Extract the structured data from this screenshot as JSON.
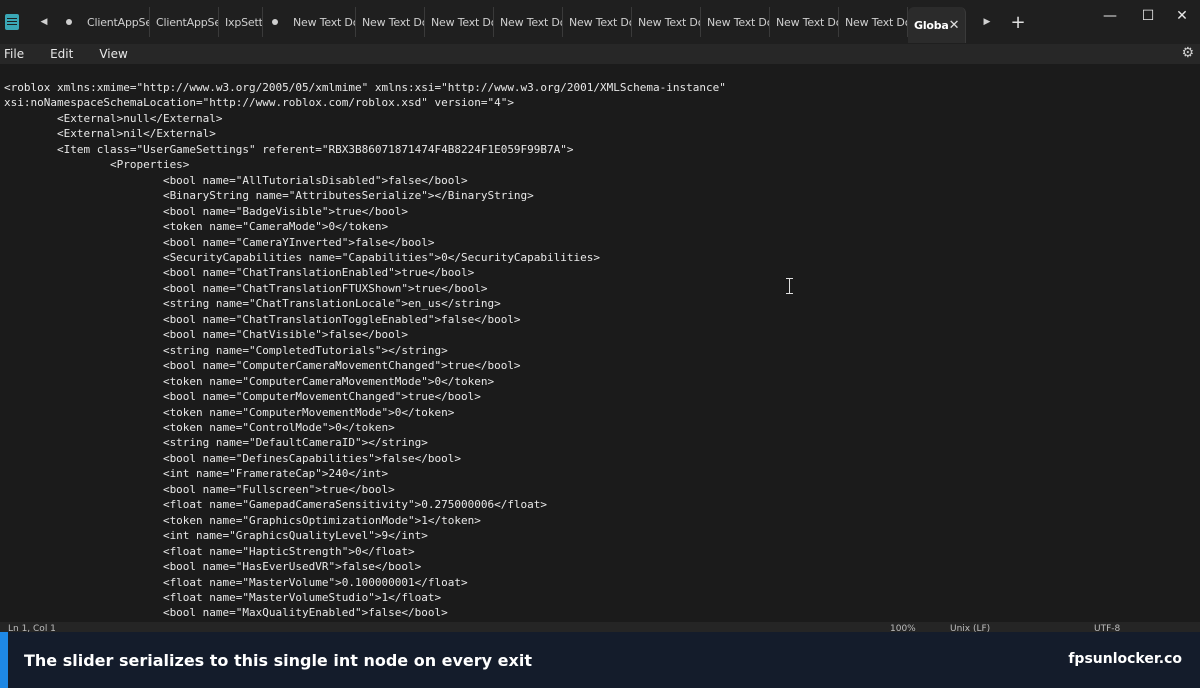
{
  "tabs": [
    {
      "label": "ClientAppSe"
    },
    {
      "label": "ClientAppSe"
    },
    {
      "label": "IxpSett"
    },
    {
      "label": "New Text Do"
    },
    {
      "label": "New Text Do"
    },
    {
      "label": "New Text Do"
    },
    {
      "label": "New Text Do"
    },
    {
      "label": "New Text Do"
    },
    {
      "label": "New Text Do"
    },
    {
      "label": "New Text Do"
    },
    {
      "label": "New Text Do"
    },
    {
      "label": "New Text Do"
    }
  ],
  "active_tab": {
    "label": "Globa",
    "close": "✕"
  },
  "new_tab": "+",
  "window": {
    "minimize": "—",
    "maximize": "☐",
    "close": "✕"
  },
  "menu": {
    "file": "File",
    "edit": "Edit",
    "view": "View"
  },
  "code_text": "<roblox xmlns:xmime=\"http://www.w3.org/2005/05/xmlmime\" xmlns:xsi=\"http://www.w3.org/2001/XMLSchema-instance\"\nxsi:noNamespaceSchemaLocation=\"http://www.roblox.com/roblox.xsd\" version=\"4\">\n        <External>null</External>\n        <External>nil</External>\n        <Item class=\"UserGameSettings\" referent=\"RBX3B86071871474F4B8224F1E059F99B7A\">\n                <Properties>\n                        <bool name=\"AllTutorialsDisabled\">false</bool>\n                        <BinaryString name=\"AttributesSerialize\"></BinaryString>\n                        <bool name=\"BadgeVisible\">true</bool>\n                        <token name=\"CameraMode\">0</token>\n                        <bool name=\"CameraYInverted\">false</bool>\n                        <SecurityCapabilities name=\"Capabilities\">0</SecurityCapabilities>\n                        <bool name=\"ChatTranslationEnabled\">true</bool>\n                        <bool name=\"ChatTranslationFTUXShown\">true</bool>\n                        <string name=\"ChatTranslationLocale\">en_us</string>\n                        <bool name=\"ChatTranslationToggleEnabled\">false</bool>\n                        <bool name=\"ChatVisible\">false</bool>\n                        <string name=\"CompletedTutorials\"></string>\n                        <bool name=\"ComputerCameraMovementChanged\">true</bool>\n                        <token name=\"ComputerCameraMovementMode\">0</token>\n                        <bool name=\"ComputerMovementChanged\">true</bool>\n                        <token name=\"ComputerMovementMode\">0</token>\n                        <token name=\"ControlMode\">0</token>\n                        <string name=\"DefaultCameraID\"></string>\n                        <bool name=\"DefinesCapabilities\">false</bool>\n                        <int name=\"FramerateCap\">240</int>\n                        <bool name=\"Fullscreen\">true</bool>\n                        <float name=\"GamepadCameraSensitivity\">0.275000006</float>\n                        <token name=\"GraphicsOptimizationMode\">1</token>\n                        <int name=\"GraphicsQualityLevel\">9</int>\n                        <float name=\"HapticStrength\">0</float>\n                        <bool name=\"HasEverUsedVR\">false</bool>\n                        <float name=\"MasterVolume\">0.100000001</float>\n                        <float name=\"MasterVolumeStudio\">1</float>\n                        <bool name=\"MaxQualityEnabled\">false</bool>",
  "status": {
    "position": "Ln 1, Col 1",
    "zoom": "100%",
    "line_ending": "Unix (LF)",
    "encoding": "UTF-8"
  },
  "caption": {
    "text": "The slider serializes to this single int node on every exit",
    "site": "fpsunlocker.co"
  }
}
